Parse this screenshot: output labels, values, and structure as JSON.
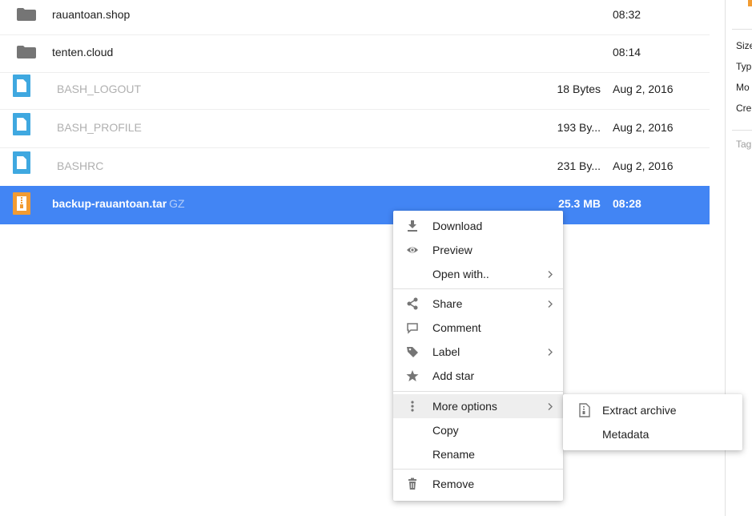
{
  "files": [
    {
      "type": "folder",
      "name": "rauantoan.shop",
      "size": "",
      "modified": "08:32"
    },
    {
      "type": "folder",
      "name": "tenten.cloud",
      "size": "",
      "modified": "08:14"
    },
    {
      "type": "file",
      "name": "BASH_LOGOUT",
      "size": "18 Bytes",
      "modified": "Aug 2, 2016"
    },
    {
      "type": "file",
      "name": "BASH_PROFILE",
      "size": "193 By...",
      "modified": "Aug 2, 2016"
    },
    {
      "type": "file",
      "name": "BASHRC",
      "size": "231 By...",
      "modified": "Aug 2, 2016"
    },
    {
      "type": "archive",
      "name": "backup-rauantoan.tar",
      "ext": "GZ",
      "size": "25.3 MB",
      "modified": "08:28",
      "selected": true
    }
  ],
  "details": {
    "size_label": "Size",
    "type_label": "Typ",
    "modified_label": "Mo",
    "created_label": "Cre",
    "tags_label": "Tag"
  },
  "context_menu": {
    "items": [
      {
        "label": "Download",
        "icon": "download-icon"
      },
      {
        "label": "Preview",
        "icon": "eye-icon"
      },
      {
        "label": "Open with..",
        "icon": "",
        "submenu": true
      },
      {
        "label": "Share",
        "icon": "share-icon",
        "submenu": true
      },
      {
        "label": "Comment",
        "icon": "comment-icon"
      },
      {
        "label": "Label",
        "icon": "tag-icon",
        "submenu": true
      },
      {
        "label": "Add star",
        "icon": "star-icon"
      },
      {
        "label": "More options",
        "icon": "more-vertical-icon",
        "submenu": true,
        "active": true
      },
      {
        "label": "Copy",
        "icon": ""
      },
      {
        "label": "Rename",
        "icon": ""
      },
      {
        "label": "Remove",
        "icon": "trash-icon"
      }
    ]
  },
  "submenu": {
    "items": [
      {
        "label": "Extract archive",
        "icon": "archive-file-icon"
      },
      {
        "label": "Metadata",
        "icon": ""
      }
    ]
  },
  "colors": {
    "selection": "#4285f4",
    "folder": "#757575",
    "file_icon": "#3fa8e0",
    "archive_icon": "#f29b32",
    "menu_active": "#eeeeee"
  }
}
